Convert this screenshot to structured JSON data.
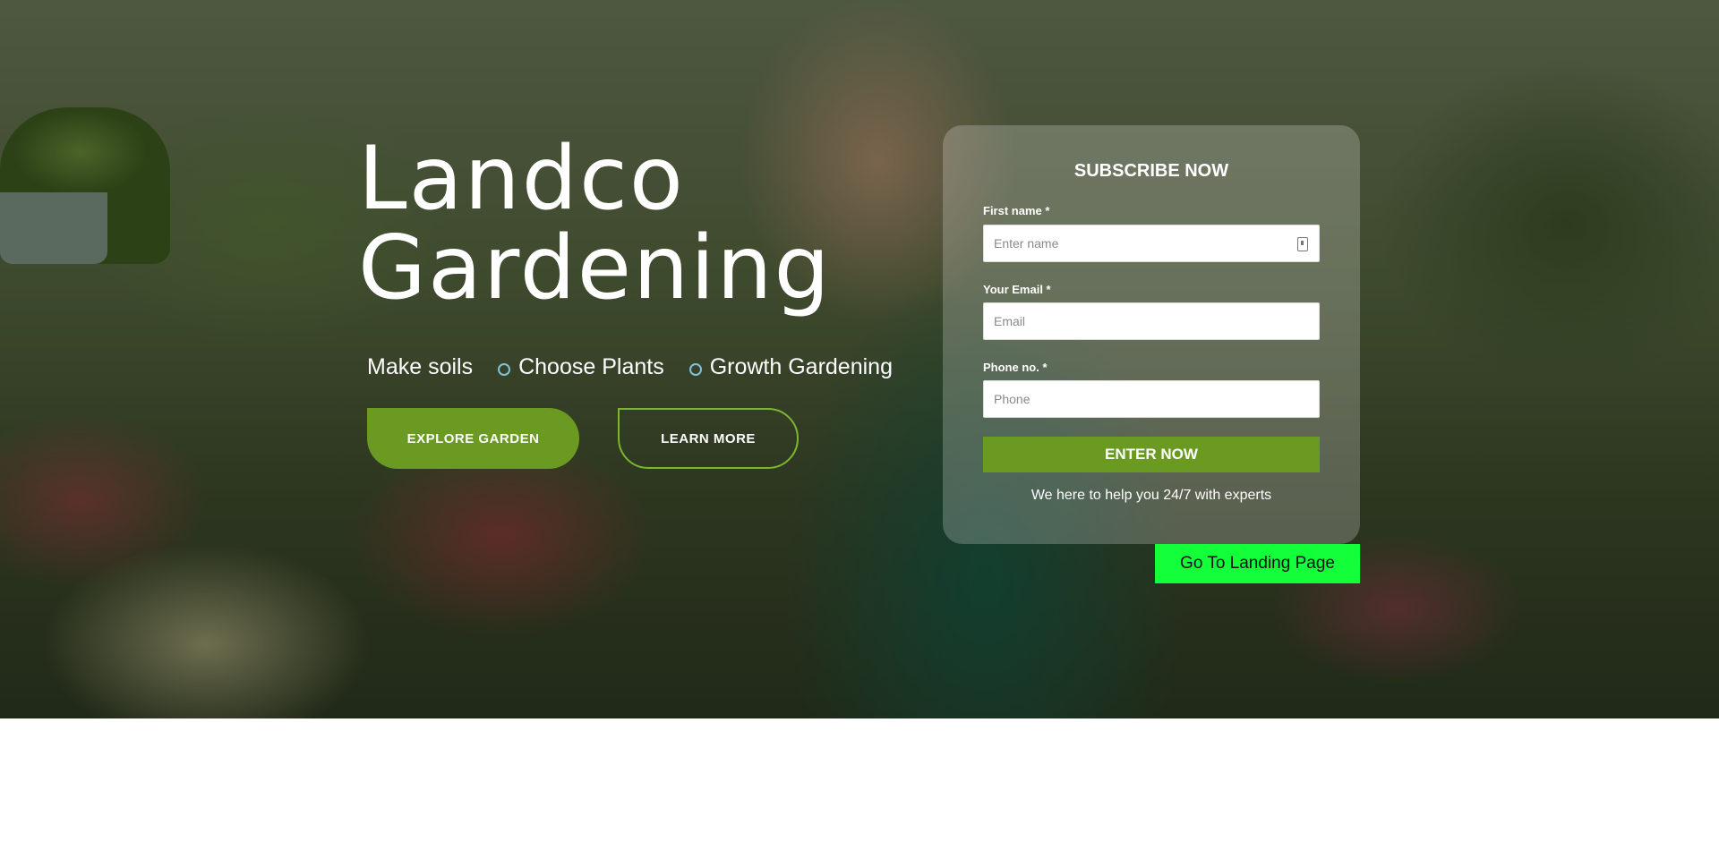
{
  "hero": {
    "title_line1": "Landco",
    "title_line2": "Gardening",
    "features": [
      "Make soils",
      "Choose Plants",
      "Growth Gardening"
    ],
    "explore_label": "EXPLORE GARDEN",
    "learn_label": "LEARN MORE"
  },
  "subscribe": {
    "title": "SUBSCRIBE NOW",
    "first_name_label": "First name *",
    "first_name_placeholder": "Enter name",
    "first_name_icon": "contact-card-icon",
    "email_label": "Your Email *",
    "email_placeholder": "Email",
    "phone_label": "Phone no. *",
    "phone_placeholder": "Phone",
    "submit_label": "ENTER NOW",
    "help_text": "We here to help you 24/7 with experts"
  },
  "landing_button_label": "Go To Landing Page",
  "colors": {
    "accent_green": "#6b9a22",
    "outline_green": "#7cb62e",
    "landing_green": "#13ff3a",
    "feature_dot": "#7fc3d9"
  }
}
